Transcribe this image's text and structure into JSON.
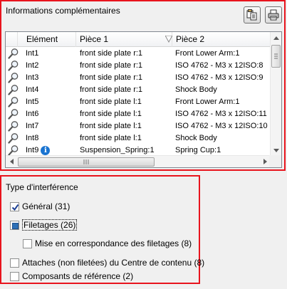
{
  "panel_info": {
    "title": "Informations complémentaires",
    "copy_icon": "copy-to-clipboard-icon",
    "print_icon": "printer-icon"
  },
  "grid": {
    "columns": [
      "Elément",
      "Pièce 1",
      "Pièce 2"
    ],
    "rows": [
      {
        "element": "Int1",
        "piece1": "front side plate r:1",
        "piece2": "Front Lower Arm:1",
        "info": false
      },
      {
        "element": "Int2",
        "piece1": "front side plate r:1",
        "piece2": "ISO 4762 - M3 x 12ISO:8",
        "info": false
      },
      {
        "element": "Int3",
        "piece1": "front side plate r:1",
        "piece2": "ISO 4762 - M3 x 12ISO:9",
        "info": false
      },
      {
        "element": "Int4",
        "piece1": "front side plate r:1",
        "piece2": "Shock Body",
        "info": false
      },
      {
        "element": "Int5",
        "piece1": "front side plate l:1",
        "piece2": "Front Lower Arm:1",
        "info": false
      },
      {
        "element": "Int6",
        "piece1": "front side plate l:1",
        "piece2": "ISO 4762 - M3 x 12ISO:11",
        "info": false
      },
      {
        "element": "Int7",
        "piece1": "front side plate l:1",
        "piece2": "ISO 4762 - M3 x 12ISO:10",
        "info": false
      },
      {
        "element": "Int8",
        "piece1": "front side plate l:1",
        "piece2": "Shock Body",
        "info": false
      },
      {
        "element": "Int9",
        "piece1": "Suspension_Spring:1",
        "piece2": "Spring Cup:1",
        "info": true
      }
    ],
    "row_icon": "magnifier-icon",
    "info_icon": "info-icon",
    "info_glyph": "i"
  },
  "panel_type": {
    "title": "Type d'interférence",
    "options": [
      {
        "label": "Général (31)",
        "state": "checked"
      },
      {
        "label": "Filetages (26)",
        "state": "mixed"
      },
      {
        "label": "Mise en correspondance des filetages (8)",
        "state": "unchecked"
      },
      {
        "label": "Attaches (non filetées) du Centre de contenu (8)",
        "state": "unchecked"
      },
      {
        "label": "Composants de référence (2)",
        "state": "unchecked"
      }
    ]
  },
  "colors": {
    "highlight_border": "#e8141d",
    "info_blue": "#1a74d1",
    "mixed_check": "#2d6fb6"
  }
}
